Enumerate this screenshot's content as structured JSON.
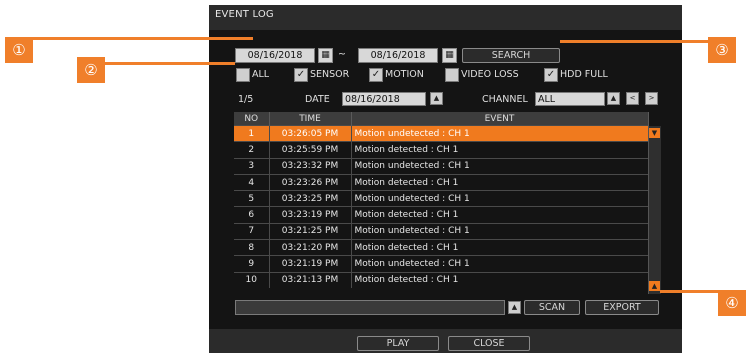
{
  "dialog": {
    "title": "EVENT LOG"
  },
  "search": {
    "from_date": "08/16/2018",
    "separator": "~",
    "to_date": "08/16/2018",
    "search_label": "SEARCH"
  },
  "filters": [
    {
      "label": "ALL",
      "checked": false
    },
    {
      "label": "SENSOR",
      "checked": true
    },
    {
      "label": "MOTION",
      "checked": true
    },
    {
      "label": "VIDEO LOSS",
      "checked": false
    },
    {
      "label": "HDD FULL",
      "checked": true
    }
  ],
  "pager": {
    "page": "1/5",
    "date_label": "DATE",
    "date_value": "08/16/2018",
    "channel_label": "CHANNEL",
    "channel_value": "ALL"
  },
  "table": {
    "headers": [
      "NO",
      "TIME",
      "EVENT"
    ],
    "rows": [
      [
        "1",
        "03:26:05 PM",
        "Motion undetected : CH 1"
      ],
      [
        "2",
        "03:25:59 PM",
        "Motion detected : CH 1"
      ],
      [
        "3",
        "03:23:32 PM",
        "Motion undetected : CH 1"
      ],
      [
        "4",
        "03:23:26 PM",
        "Motion detected : CH 1"
      ],
      [
        "5",
        "03:23:25 PM",
        "Motion undetected : CH 1"
      ],
      [
        "6",
        "03:23:19 PM",
        "Motion detected : CH 1"
      ],
      [
        "7",
        "03:21:25 PM",
        "Motion undetected : CH 1"
      ],
      [
        "8",
        "03:21:20 PM",
        "Motion detected : CH 1"
      ],
      [
        "9",
        "03:21:19 PM",
        "Motion undetected : CH 1"
      ],
      [
        "10",
        "03:21:13 PM",
        "Motion detected : CH 1"
      ]
    ],
    "selected_row": 0
  },
  "bottom": {
    "scan_label": "SCAN",
    "export_label": "EXPORT"
  },
  "footer": {
    "play_label": "PLAY",
    "close_label": "CLOSE"
  },
  "callouts": [
    "①",
    "②",
    "③",
    "④"
  ],
  "colors": {
    "accent": "#f07a1e",
    "dialog_bg": "#141414",
    "bar_bg": "#2b2b2b"
  }
}
